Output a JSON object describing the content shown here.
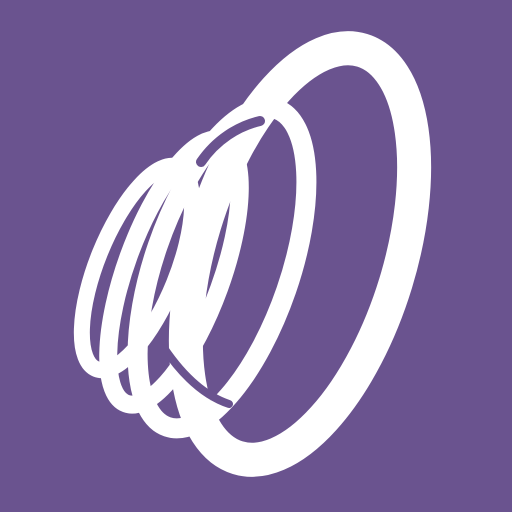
{
  "icon": {
    "name": "spiral-rings-logo",
    "background_color": "#6a538f",
    "foreground_color": "#ffffff"
  }
}
